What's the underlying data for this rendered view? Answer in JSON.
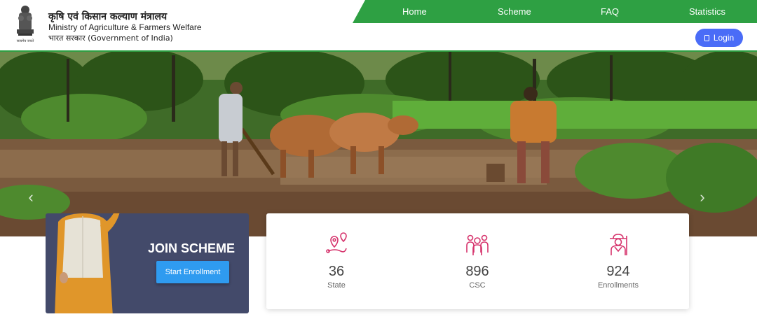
{
  "header": {
    "ministry_hindi": "कृषि एवं किसान कल्याण मंत्रालय",
    "ministry_english": "Ministry of Agriculture & Farmers Welfare",
    "government": "भारत सरकार (Government of India)",
    "emblem_caption": "सत्यमेव जयते"
  },
  "nav": {
    "items": [
      "Home",
      "Scheme",
      "FAQ",
      "Statistics"
    ],
    "login_label": "Login"
  },
  "colors": {
    "nav_green": "#2ea043",
    "login_blue": "#4a6cf7",
    "join_card_bg": "#434a6a",
    "enroll_button": "#2f9bf0",
    "stat_icon_pink": "#d6336c"
  },
  "banner": {
    "prev_icon": "chevron-left-icon",
    "next_icon": "chevron-right-icon"
  },
  "join": {
    "title": "JOIN SCHEME",
    "button_label": "Start Enrollment"
  },
  "stats": [
    {
      "value": "36",
      "label": "State",
      "icon": "location-pin-icon"
    },
    {
      "value": "896",
      "label": "CSC",
      "icon": "people-group-icon"
    },
    {
      "value": "924",
      "label": "Enrollments",
      "icon": "farmer-icon"
    }
  ]
}
